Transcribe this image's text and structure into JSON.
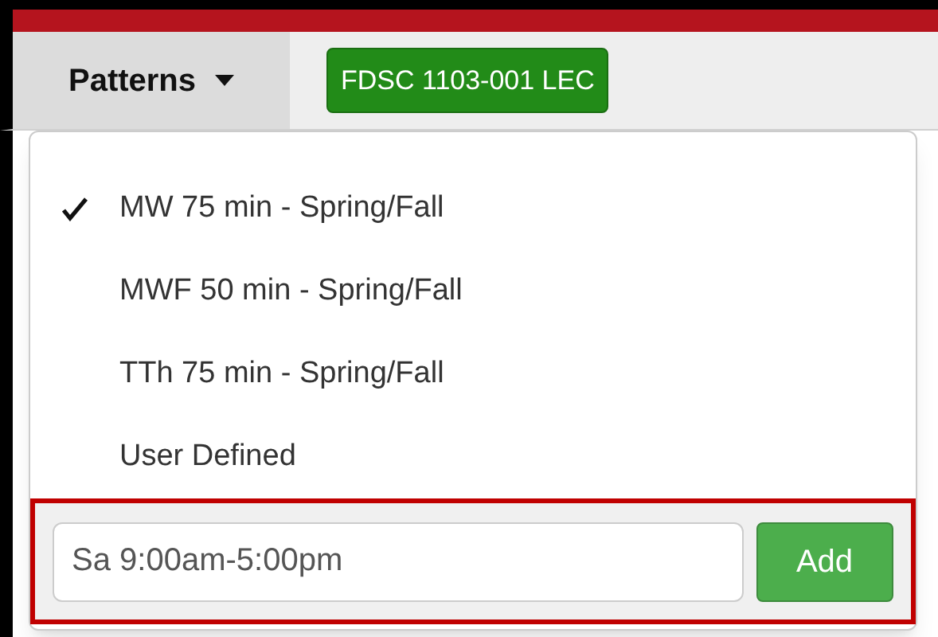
{
  "toolbar": {
    "menu_button": "Patterns",
    "course_badge": "FDSC 1103-001 LEC"
  },
  "dropdown": {
    "items": [
      {
        "label": "MW 75 min - Spring/Fall",
        "selected": true
      },
      {
        "label": "MWF 50 min - Spring/Fall",
        "selected": false
      },
      {
        "label": "TTh 75 min - Spring/Fall",
        "selected": false
      },
      {
        "label": "User Defined",
        "selected": false
      }
    ],
    "custom_pattern": {
      "value": "Sa 9:00am-5:00pm",
      "button": "Add"
    }
  }
}
